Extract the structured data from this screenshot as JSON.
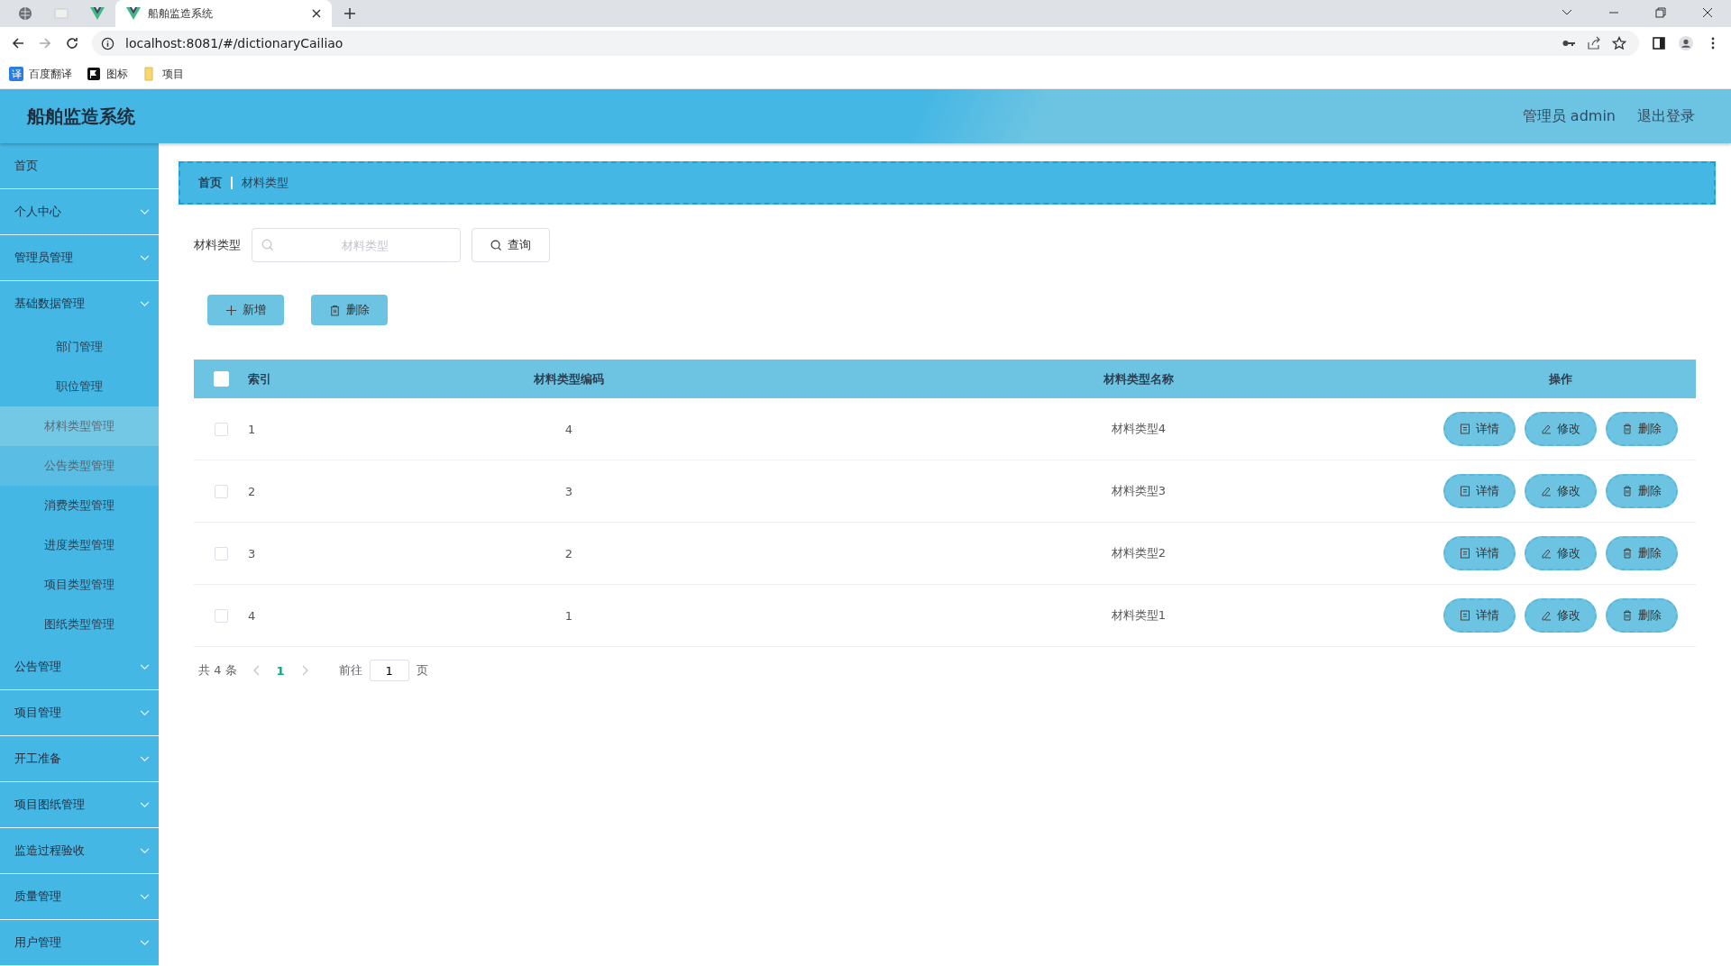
{
  "browser": {
    "tabs": [
      {
        "kind": "globe",
        "selected": false
      },
      {
        "kind": "page",
        "selected": false
      },
      {
        "kind": "vue",
        "selected": false
      },
      {
        "kind": "vue",
        "title": "船舶监造系统",
        "selected": true
      }
    ],
    "address": "localhost:8081/#/dictionaryCailiao",
    "bookmarks": [
      {
        "kind": "translate",
        "badge": "译",
        "label": "百度翻译"
      },
      {
        "kind": "flag",
        "label": "图标"
      },
      {
        "kind": "folder",
        "label": "项目"
      }
    ]
  },
  "header": {
    "title": "船舶监造系统",
    "user": "管理员 admin",
    "logout": "退出登录"
  },
  "sidebar": {
    "items": [
      {
        "label": "首页",
        "expandable": false,
        "expanded": false
      },
      {
        "label": "个人中心",
        "expandable": true,
        "expanded": false
      },
      {
        "label": "管理员管理",
        "expandable": true,
        "expanded": false
      },
      {
        "label": "基础数据管理",
        "expandable": true,
        "expanded": true,
        "children": [
          {
            "label": "部门管理",
            "selected": false,
            "hovered": false
          },
          {
            "label": "职位管理",
            "selected": false,
            "hovered": false
          },
          {
            "label": "材料类型管理",
            "selected": true,
            "hovered": false
          },
          {
            "label": "公告类型管理",
            "selected": false,
            "hovered": true
          },
          {
            "label": "消费类型管理",
            "selected": false,
            "hovered": false
          },
          {
            "label": "进度类型管理",
            "selected": false,
            "hovered": false
          },
          {
            "label": "项目类型管理",
            "selected": false,
            "hovered": false
          },
          {
            "label": "图纸类型管理",
            "selected": false,
            "hovered": false
          }
        ]
      },
      {
        "label": "公告管理",
        "expandable": true,
        "expanded": false
      },
      {
        "label": "项目管理",
        "expandable": true,
        "expanded": false
      },
      {
        "label": "开工准备",
        "expandable": true,
        "expanded": false
      },
      {
        "label": "项目图纸管理",
        "expandable": true,
        "expanded": false
      },
      {
        "label": "监造过程验收",
        "expandable": true,
        "expanded": false
      },
      {
        "label": "质量管理",
        "expandable": true,
        "expanded": false
      },
      {
        "label": "用户管理",
        "expandable": true,
        "expanded": false
      }
    ]
  },
  "breadcrumb": [
    "首页",
    "材料类型"
  ],
  "search": {
    "label": "材料类型",
    "placeholder": "材料类型",
    "button": "查询"
  },
  "actions": [
    {
      "kind": "add",
      "label": "新增"
    },
    {
      "kind": "delete",
      "label": "删除"
    }
  ],
  "table": {
    "columns": [
      "索引",
      "材料类型编码",
      "材料类型名称",
      "操作"
    ],
    "all_checked": false,
    "rows": [
      {
        "index": "1",
        "code": "4",
        "name": "材料类型4",
        "checked": false,
        "actions": [
          {
            "kind": "detail",
            "label": "详情"
          },
          {
            "kind": "edit",
            "label": "修改"
          },
          {
            "kind": "delete",
            "label": "删除"
          }
        ]
      },
      {
        "index": "2",
        "code": "3",
        "name": "材料类型3",
        "checked": false,
        "actions": [
          {
            "kind": "detail",
            "label": "详情"
          },
          {
            "kind": "edit",
            "label": "修改"
          },
          {
            "kind": "delete",
            "label": "删除"
          }
        ]
      },
      {
        "index": "3",
        "code": "2",
        "name": "材料类型2",
        "checked": false,
        "actions": [
          {
            "kind": "detail",
            "label": "详情"
          },
          {
            "kind": "edit",
            "label": "修改"
          },
          {
            "kind": "delete",
            "label": "删除"
          }
        ]
      },
      {
        "index": "4",
        "code": "1",
        "name": "材料类型1",
        "checked": false,
        "actions": [
          {
            "kind": "detail",
            "label": "详情"
          },
          {
            "kind": "edit",
            "label": "修改"
          },
          {
            "kind": "delete",
            "label": "删除"
          }
        ]
      }
    ]
  },
  "pagination": {
    "total": "共 4 条",
    "pages": [
      {
        "label": "1",
        "selected": true
      }
    ],
    "goto_label": "前往",
    "goto_value": "1",
    "suffix": "页"
  }
}
